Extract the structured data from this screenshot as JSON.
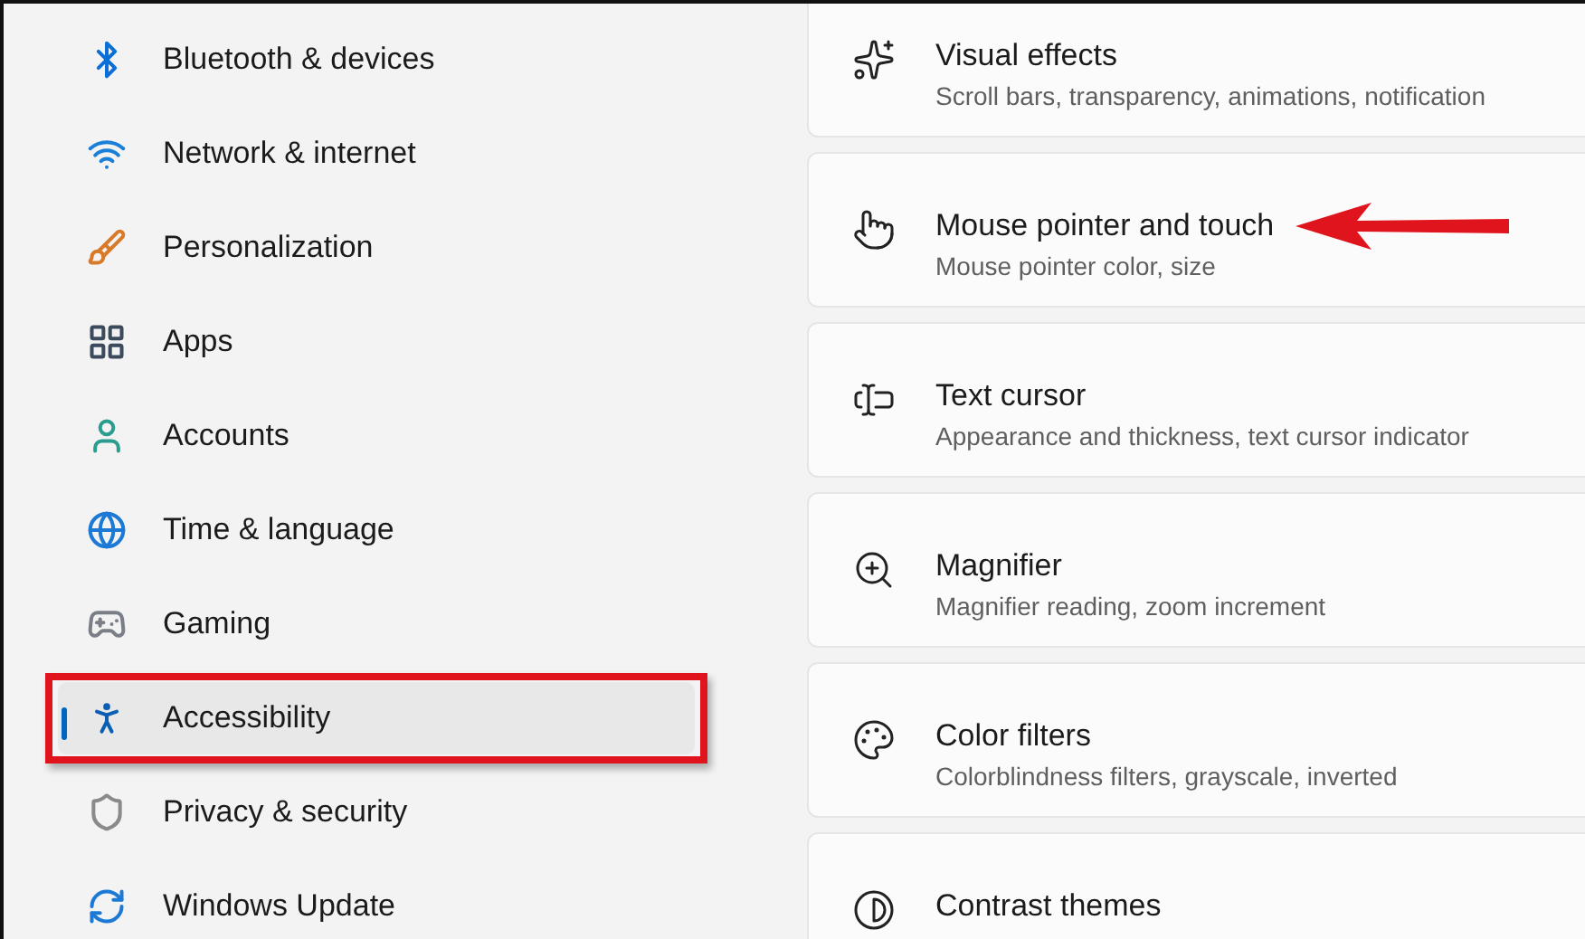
{
  "sidebar": {
    "items": [
      {
        "label": "Bluetooth & devices",
        "selected": false,
        "highlighted": false
      },
      {
        "label": "Network & internet",
        "selected": false,
        "highlighted": false
      },
      {
        "label": "Personalization",
        "selected": false,
        "highlighted": false
      },
      {
        "label": "Apps",
        "selected": false,
        "highlighted": false
      },
      {
        "label": "Accounts",
        "selected": false,
        "highlighted": false
      },
      {
        "label": "Time & language",
        "selected": false,
        "highlighted": false
      },
      {
        "label": "Gaming",
        "selected": false,
        "highlighted": false
      },
      {
        "label": "Accessibility",
        "selected": true,
        "highlighted": true
      },
      {
        "label": "Privacy & security",
        "selected": false,
        "highlighted": false
      },
      {
        "label": "Windows Update",
        "selected": false,
        "highlighted": false
      }
    ]
  },
  "cards": [
    {
      "title": "Visual effects",
      "subtitle": "Scroll bars, transparency, animations, notification",
      "pointed": false
    },
    {
      "title": "Mouse pointer and touch",
      "subtitle": "Mouse pointer color, size",
      "pointed": true
    },
    {
      "title": "Text cursor",
      "subtitle": "Appearance and thickness, text cursor indicator",
      "pointed": false
    },
    {
      "title": "Magnifier",
      "subtitle": "Magnifier reading, zoom increment",
      "pointed": false
    },
    {
      "title": "Color filters",
      "subtitle": "Colorblindness filters, grayscale, inverted",
      "pointed": false
    },
    {
      "title": "Contrast themes",
      "pointed": false
    }
  ]
}
